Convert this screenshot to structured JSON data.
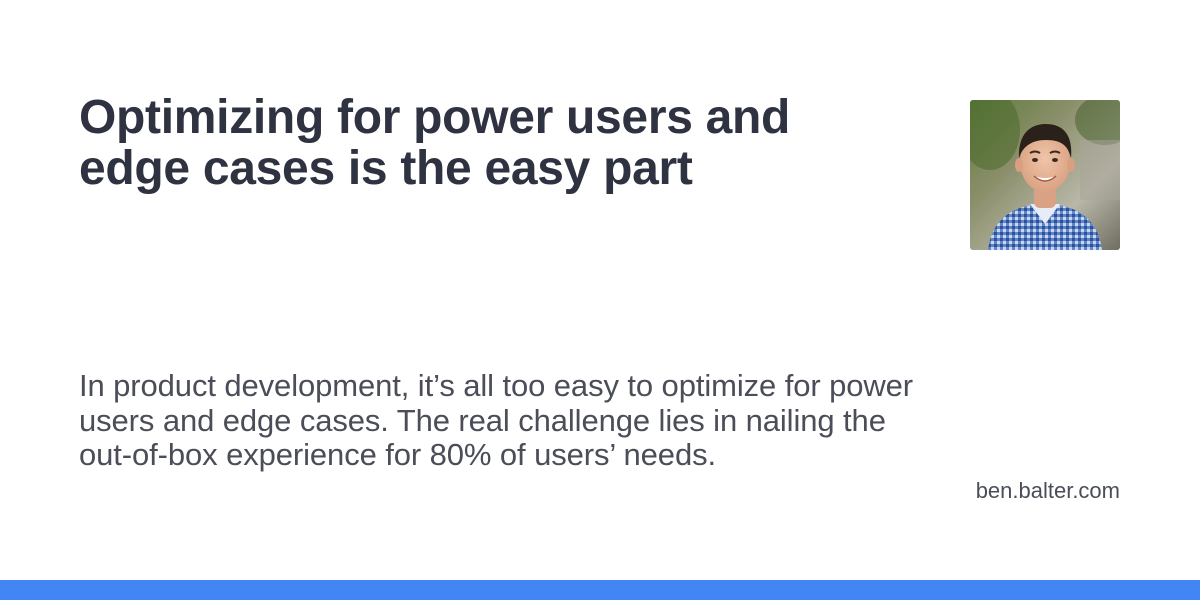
{
  "card": {
    "title": "Optimizing for power users and edge cases is the easy part",
    "description": "In product development, it’s all too easy to optimize for power users and edge cases. The real challenge lies in nailing the out-of-box experience for 80% of users’ needs.",
    "domain": "ben.balter.com"
  },
  "colors": {
    "accent": "#4285f4",
    "title_text": "#2f3241",
    "body_text": "#4b4e58",
    "background": "#ffffff"
  },
  "icons": {
    "avatar": "author-avatar-photo"
  }
}
